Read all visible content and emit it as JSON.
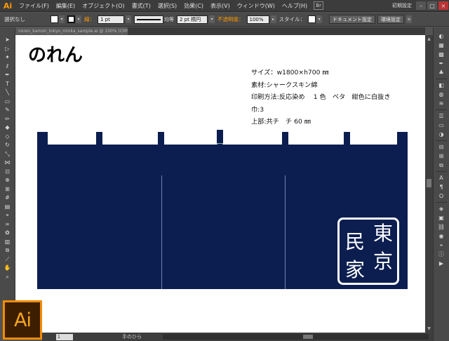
{
  "menubar": {
    "logo": "Ai",
    "items": [
      "ファイル(F)",
      "編集(E)",
      "オブジェクト(O)",
      "書式(T)",
      "選択(S)",
      "効果(C)",
      "表示(V)",
      "ウィンドウ(W)",
      "ヘルプ(H)"
    ],
    "workspace": "初期設定"
  },
  "controlbar": {
    "selection": "選択なし",
    "stroke_label": "線：",
    "stroke_weight": "1 pt",
    "stroke_profile": "均等",
    "brush": "2 pt 楕円",
    "opacity_label": "不透明度：",
    "opacity_value": "100%",
    "style_label": "スタイル：",
    "doc_setup_button": "ドキュメント設定",
    "prefs_button": "環境設定"
  },
  "document_tab": "noren_kamon_tokyo_minka_sample.ai @ 100% (CMYK/プレビュー)",
  "artboard": {
    "title": "のれん",
    "spec_lines": [
      "サイズ：w1800×h700 ㎜",
      "素材:シャークスキン綿",
      "印刷方法:反応染め　 1 色　ベタ　紺色に白抜き",
      "巾:3",
      "上部:共チ　チ 60 ㎜"
    ],
    "seal_text": {
      "col_right": [
        "東",
        "京"
      ],
      "col_left": [
        "民",
        "家"
      ]
    }
  },
  "status": {
    "zoom": "1",
    "tool_text": "手のひら"
  },
  "badge": "Ai",
  "colors": {
    "noren": "#0b1e4f",
    "accent": "#f28c00"
  }
}
